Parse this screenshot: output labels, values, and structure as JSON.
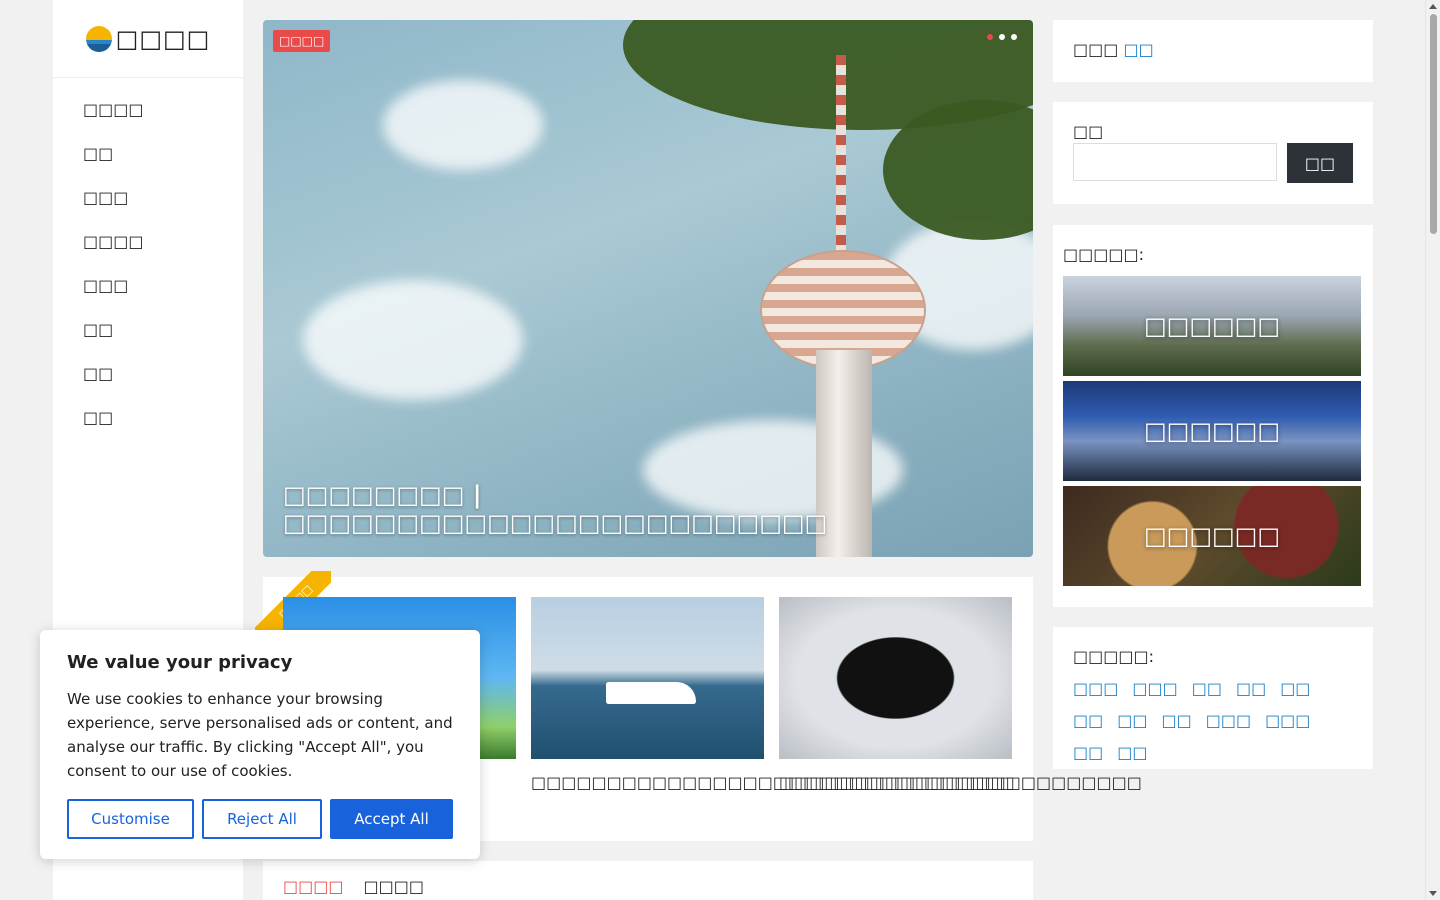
{
  "site": {
    "logo_text": "□□□□"
  },
  "nav": {
    "items": [
      {
        "label": "□□□□"
      },
      {
        "label": "□□"
      },
      {
        "label": "□□□"
      },
      {
        "label": "□□□□"
      },
      {
        "label": "□□□"
      },
      {
        "label": "□□"
      },
      {
        "label": "□□"
      },
      {
        "label": "□□"
      }
    ]
  },
  "hero": {
    "badge": "□□□□",
    "title": "□□□□□□□□ | □□□□□□□□□□□□□□□□□□□□□□□□"
  },
  "features": {
    "ribbon": "□□□□",
    "items": [
      {
        "title": ""
      },
      {
        "title": "□□□□□□□□□□□□□□□□□□□□□□□□□□□□□□□□"
      },
      {
        "title": "□□□□□□□□□□□□□□□□□□□□□□□□"
      }
    ]
  },
  "tabs": [
    {
      "label": "□□□□"
    },
    {
      "label": "□□□□"
    }
  ],
  "login": {
    "prefix": "□□□",
    "link": "□□"
  },
  "search": {
    "label": "□□",
    "button": "□□",
    "placeholder": ""
  },
  "hot": {
    "label": "□□□□□:",
    "items": [
      {
        "caption": "□□□□□□"
      },
      {
        "caption": "□□□□□□"
      },
      {
        "caption": "□□□□□□"
      }
    ]
  },
  "tags": {
    "label": "□□□□□:",
    "items": [
      "□□□",
      "□□□",
      "□□",
      "□□",
      "□□",
      "□□",
      "□□",
      "□□",
      "□□□",
      "□□□",
      "□□",
      "□□"
    ]
  },
  "cookie": {
    "title": "We value your privacy",
    "body": "We use cookies to enhance your browsing experience, serve personalised ads or content, and analyse our traffic. By clicking \"Accept All\", you consent to our use of cookies.",
    "customise": "Customise",
    "reject": "Reject All",
    "accept": "Accept All"
  },
  "colors": {
    "accent_red": "#e94a4a",
    "link_blue": "#1a7ec4",
    "cookie_blue": "#1863dc",
    "ribbon_gold": "#f5b400"
  }
}
